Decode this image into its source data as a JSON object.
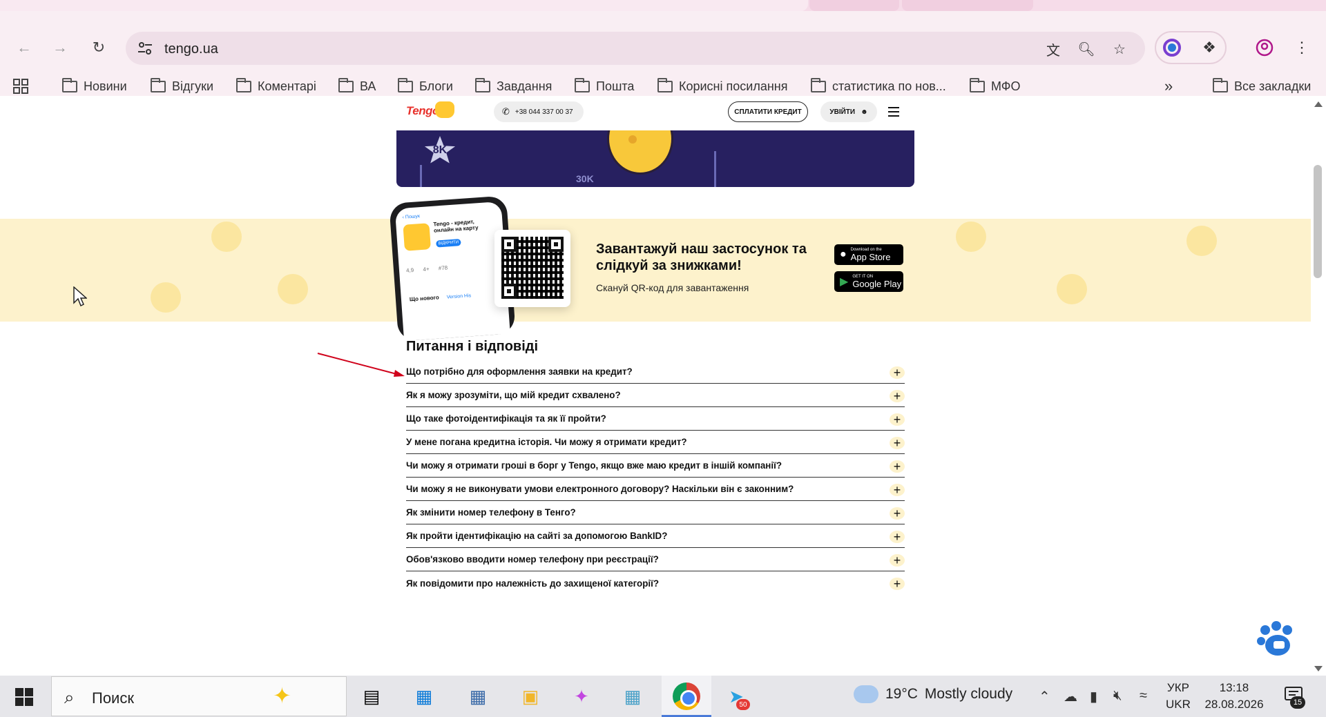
{
  "browser": {
    "url": "tengo.ua",
    "bookmarks": [
      "Новини",
      "Відгуки",
      "Коментарі",
      "ВА",
      "Блоги",
      "Завдання",
      "Пошта",
      "Корисні посилання",
      "статистика по нов...",
      "МФО"
    ],
    "all_bookmarks_label": "Все закладки"
  },
  "site": {
    "logo_text": "Tengo",
    "phone": "+38 044 337 00 37",
    "pay_button": "СПЛАТИТИ КРЕДИТ",
    "login_button": "УВІЙТИ",
    "promo": {
      "label_8k": "8K",
      "label_30k": "30K"
    },
    "app_strip": {
      "title": "Завантажуй наш застосунок та слідкуй за знижками!",
      "subtitle": "Скануй QR-код для завантаження",
      "app_store_small": "Download on the",
      "app_store_large": "App Store",
      "google_play_small": "GET IT ON",
      "google_play_large": "Google Play",
      "phone_app_title": "Tengo - кредит, онлайн на карту",
      "phone_back": "‹ Пошук",
      "phone_open_btn": "ВІДКРИТИ",
      "phone_rating": "4,9",
      "phone_age": "4+",
      "phone_rank": "#78",
      "phone_whats_new": "Що нового",
      "phone_version": "Version His"
    },
    "faq": {
      "heading": "Питання і відповіді",
      "items": [
        "Що потрібно для оформлення заявки на кредит?",
        "Як я можу зрозуміти, що мій кредит схвалено?",
        "Що таке фотоідентифікація та як її пройти?",
        "У мене погана кредитна історія. Чи можу я отримати кредит?",
        "Чи можу я отримати гроші в борг у Tengo, якщо вже маю кредит в іншій компанії?",
        "Чи можу я не виконувати умови електронного договору? Наскільки він є законним?",
        "Як змінити номер телефону в Тенго?",
        "Як пройти ідентифікацію на сайті за допомогою BankID?",
        "Обов'язково вводити номер телефону при реєстрації?",
        "Як повідомити про належність до захищеної категорії?"
      ]
    }
  },
  "taskbar": {
    "search_placeholder": "Поиск",
    "weather_temp": "19°C",
    "weather_desc": "Mostly cloudy",
    "lang_top": "УКР",
    "lang_bottom": "UKR",
    "time": "13:18",
    "date": "28.08.2026",
    "telegram_badge": "50",
    "notifications_badge": "15"
  },
  "colors": {
    "toolbar_bg": "#f9eef3",
    "banner_yellow": "#fdf2cc",
    "promo_navy": "#272060",
    "logo_red": "#e8322c",
    "arrow_red": "#d0021b"
  }
}
